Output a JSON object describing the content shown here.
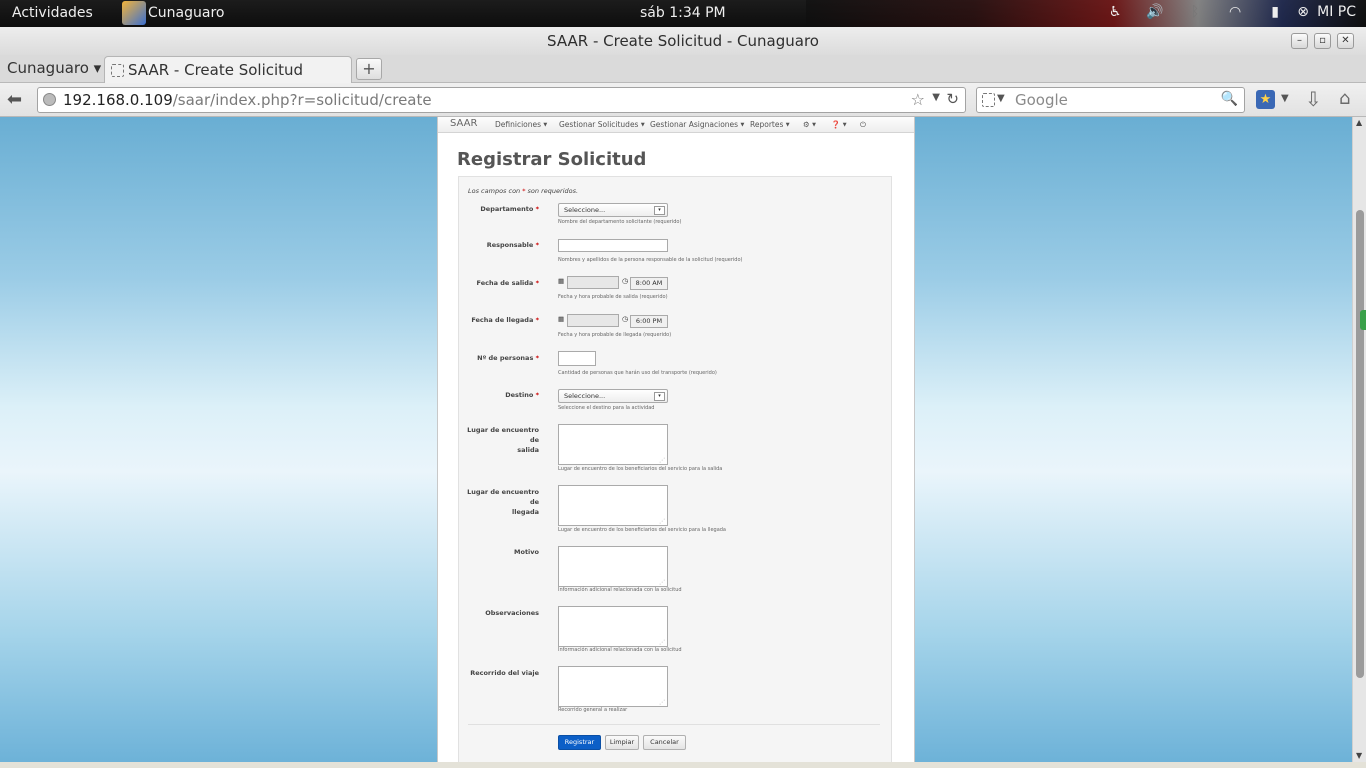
{
  "topbar": {
    "activities": "Actividades",
    "app_name": "Cunaguaro",
    "clock": "sáb  1:34 PM",
    "user": "MI PC"
  },
  "window": {
    "title": "SAAR - Create Solicitud - Cunaguaro"
  },
  "tabs": {
    "group": "Cunaguaro ▾",
    "active": "SAAR - Create Solicitud",
    "new_tab": "+"
  },
  "navbar": {
    "url_host": "192.168.0.109",
    "url_path": "/saar/index.php?r=solicitud/create",
    "search_placeholder": "Google"
  },
  "app_nav": {
    "brand": "SAAR",
    "items": [
      "Definiciones",
      "Gestionar Solicitudes",
      "Gestionar Asignaciones",
      "Reportes"
    ]
  },
  "page": {
    "heading": "Registrar Solicitud",
    "required_note_pre": "Los campos con ",
    "required_mark": "*",
    "required_note_post": " son requeridos."
  },
  "form": {
    "departamento": {
      "label": "Departamento",
      "value": "Seleccione...",
      "hint": "Nombre del departamento solicitante (requerido)"
    },
    "responsable": {
      "label": "Responsable",
      "hint": "Nombres y apellidos de la persona responsable de la solicitud (requerido)"
    },
    "fecha_salida": {
      "label": "Fecha de salida",
      "time": "8:00 AM",
      "hint": "Fecha y hora probable de salida (requerido)"
    },
    "fecha_llegada": {
      "label": "Fecha de llegada",
      "time": "6:00 PM",
      "hint": "Fecha y hora probable de llegada (requerido)"
    },
    "num_personas": {
      "label": "Nº de personas",
      "hint": "Cantidad de personas que harán uso del transporte (requerido)"
    },
    "destino": {
      "label": "Destino",
      "value": "Seleccione...",
      "hint": "Seleccione el destino para la actividad"
    },
    "encuentro_salida": {
      "label_line1": "Lugar de encuentro de",
      "label_line2": "salida",
      "hint": "Lugar de encuentro de los beneficiarios del servicio para la salida"
    },
    "encuentro_llegada": {
      "label_line1": "Lugar de encuentro de",
      "label_line2": "llegada",
      "hint": "Lugar de encuentro de los beneficiarios del servicio para la llegada"
    },
    "motivo": {
      "label": "Motivo",
      "hint": "Información adicional relacionada con la solicitud"
    },
    "observaciones": {
      "label": "Observaciones",
      "hint": "Información adicional relacionada con la solicitud"
    },
    "recorrido": {
      "label": "Recorrido del viaje",
      "hint": "Recorrido general a realizar"
    },
    "buttons": {
      "register": "Registrar",
      "clear": "Limpiar",
      "cancel": "Cancelar"
    }
  }
}
